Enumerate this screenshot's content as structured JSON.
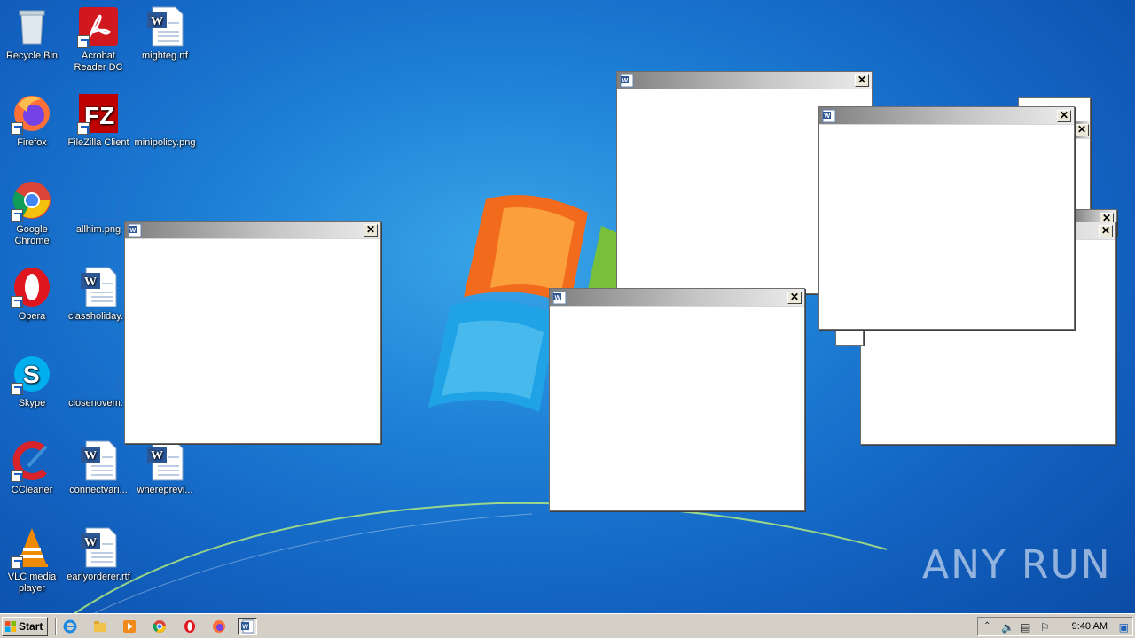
{
  "desktop_icons": [
    {
      "label": "Recycle Bin",
      "icon": "recycle-bin-icon"
    },
    {
      "label": "Acrobat Reader DC",
      "icon": "acrobat-icon"
    },
    {
      "label": "mighteg.rtf",
      "icon": "word-doc-icon"
    },
    {
      "label": "Firefox",
      "icon": "firefox-icon"
    },
    {
      "label": "FileZilla Client",
      "icon": "filezilla-icon"
    },
    {
      "label": "minipolicy.png",
      "icon": "image-file-icon"
    },
    {
      "label": "Google Chrome",
      "icon": "chrome-icon"
    },
    {
      "label": "allhim.png",
      "icon": "image-file-icon"
    },
    {
      "label": "Opera",
      "icon": "opera-icon"
    },
    {
      "label": "classholiday...",
      "icon": "word-doc-icon"
    },
    {
      "label": "Skype",
      "icon": "skype-icon"
    },
    {
      "label": "closenovem...",
      "icon": "image-file-icon"
    },
    {
      "label": "CCleaner",
      "icon": "ccleaner-icon"
    },
    {
      "label": "connectvari...",
      "icon": "word-doc-icon"
    },
    {
      "label": "whereprevi...",
      "icon": "word-doc-icon"
    },
    {
      "label": "VLC media player",
      "icon": "vlc-icon"
    },
    {
      "label": "earlyorderer.rtf",
      "icon": "word-doc-icon"
    }
  ],
  "taskbar": {
    "start_label": "Start",
    "clock": "9:40 AM",
    "pinned": [
      "ie-icon",
      "explorer-icon",
      "media-player-icon",
      "chrome-icon",
      "opera-icon",
      "firefox-icon",
      "word-icon"
    ]
  },
  "watermark": "ANY RUN",
  "colors": {
    "desktop": "#1d7fd6",
    "titlebar": "#7f7f7f",
    "taskbar": "#d4d0c8"
  }
}
